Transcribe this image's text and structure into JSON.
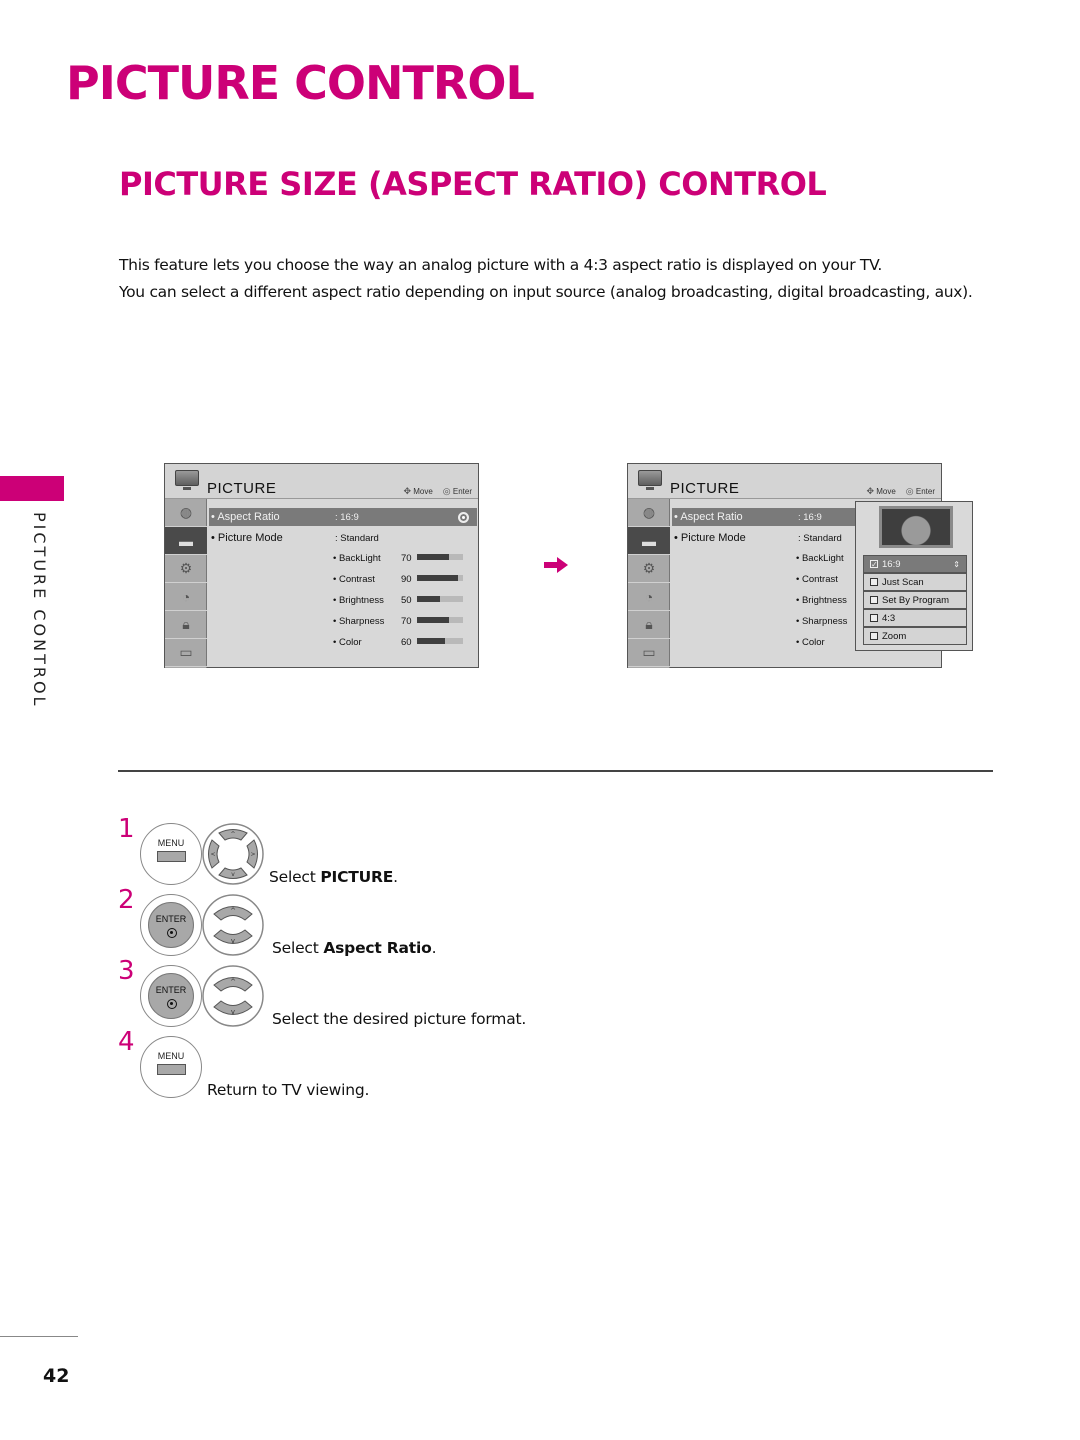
{
  "page": {
    "title": "PICTURE CONTROL",
    "section_title": "PICTURE SIZE (ASPECT RATIO) CONTROL",
    "intro": [
      "This feature lets you choose the way an analog picture with a 4:3 aspect ratio is displayed on your TV.",
      "You can select a different aspect ratio depending on input source (analog broadcasting, digital broadcasting, aux)."
    ],
    "side_label": "PICTURE CONTROL",
    "page_number": "42",
    "accent_color": "#cc0077"
  },
  "osd_left": {
    "title": "PICTURE",
    "hint_move": "Move",
    "hint_enter": "Enter",
    "sidebar_icons": [
      "globe-icon",
      "tv-icon",
      "gear-icon",
      "clock-icon",
      "lock-icon",
      "input-icon"
    ],
    "active_sidebar_index": 1,
    "aspect_ratio_label": "Aspect Ratio",
    "aspect_ratio_value": ": 16:9",
    "picture_mode_label": "Picture Mode",
    "picture_mode_value": ": Standard",
    "settings": [
      {
        "label": "BackLight",
        "value": "70",
        "level": 70
      },
      {
        "label": "Contrast",
        "value": "90",
        "level": 90
      },
      {
        "label": "Brightness",
        "value": "50",
        "level": 50
      },
      {
        "label": "Sharpness",
        "value": "70",
        "level": 70
      },
      {
        "label": "Color",
        "value": "60",
        "level": 60
      }
    ]
  },
  "osd_right": {
    "title": "PICTURE",
    "hint_move": "Move",
    "hint_enter": "Enter",
    "aspect_ratio_label": "Aspect Ratio",
    "aspect_ratio_value": ": 16:9",
    "picture_mode_label": "Picture Mode",
    "picture_mode_value": ": Standard",
    "settings": [
      "BackLight",
      "Contrast",
      "Brightness",
      "Sharpness",
      "Color"
    ],
    "popup_options": [
      {
        "label": "16:9",
        "selected": true
      },
      {
        "label": "Just Scan",
        "selected": false
      },
      {
        "label": "Set By Program",
        "selected": false
      },
      {
        "label": "4:3",
        "selected": false
      },
      {
        "label": "Zoom",
        "selected": false
      }
    ]
  },
  "steps": [
    {
      "number": "1",
      "text_prefix": "Select ",
      "text_bold": "PICTURE",
      "text_suffix": ".",
      "buttons": [
        "MENU",
        "nav-4way"
      ]
    },
    {
      "number": "2",
      "text_prefix": "Select ",
      "text_bold": "Aspect Ratio",
      "text_suffix": ".",
      "buttons": [
        "ENTER",
        "nav-updown"
      ]
    },
    {
      "number": "3",
      "text_prefix": "Select the desired picture format.",
      "text_bold": "",
      "text_suffix": "",
      "buttons": [
        "ENTER",
        "nav-updown"
      ]
    },
    {
      "number": "4",
      "text_prefix": "Return to TV viewing.",
      "text_bold": "",
      "text_suffix": "",
      "buttons": [
        "MENU"
      ]
    }
  ],
  "button_labels": {
    "menu": "MENU",
    "enter": "ENTER"
  }
}
